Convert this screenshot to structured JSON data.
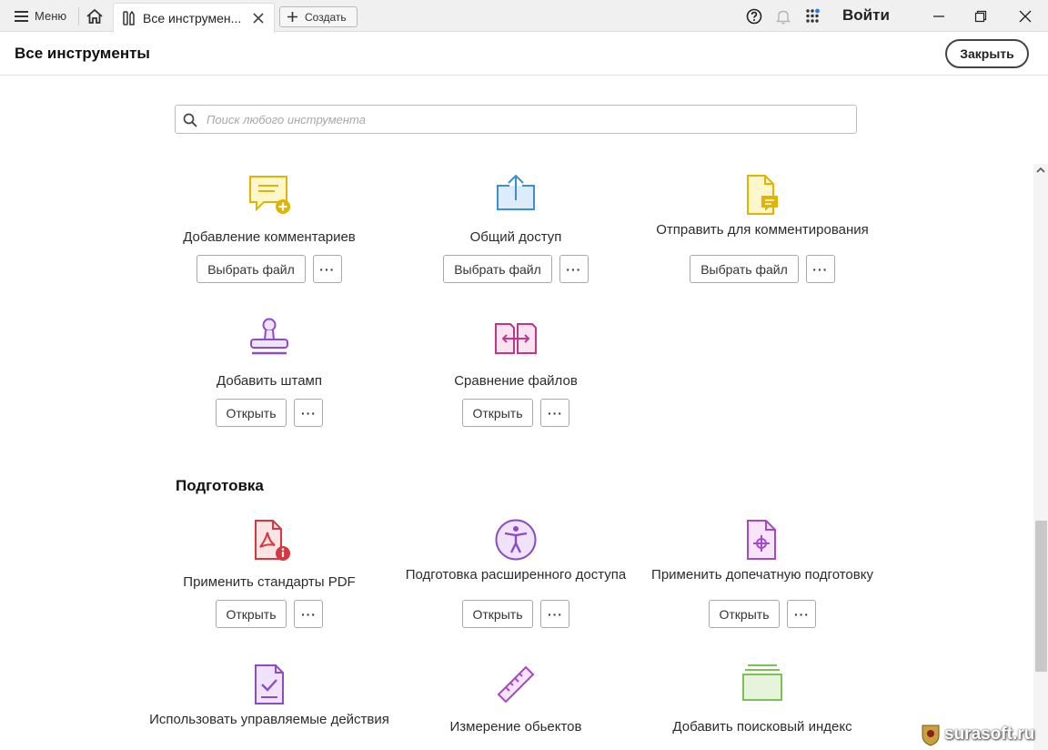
{
  "topbar": {
    "menu_label": "Меню",
    "tab_label": "Все инструмен...",
    "create_label": "Создать",
    "login_label": "Войти"
  },
  "header": {
    "title": "Все инструменты",
    "close_label": "Закрыть"
  },
  "search": {
    "placeholder": "Поиск любого инструмента",
    "value": ""
  },
  "tools_top": [
    {
      "name": "Добавление комментариев",
      "button": "Выбрать файл",
      "more": "···",
      "icon": "comment-icon"
    },
    {
      "name": "Общий доступ",
      "button": "Выбрать файл",
      "more": "···",
      "icon": "share-icon"
    },
    {
      "name": "Отправить для комментирования",
      "button": "Выбрать файл",
      "more": "···",
      "icon": "send-for-comments-icon"
    },
    {
      "name": "Добавить штамп",
      "button": "Открыть",
      "more": "···",
      "icon": "stamp-icon"
    },
    {
      "name": "Сравнение файлов",
      "button": "Открыть",
      "more": "···",
      "icon": "compare-icon"
    }
  ],
  "section": {
    "title": "Подготовка"
  },
  "tools_prep": [
    {
      "name": "Применить стандарты PDF",
      "button": "Открыть",
      "more": "···",
      "icon": "pdf-standards-icon"
    },
    {
      "name": "Подготовка расширенного доступа",
      "button": "Открыть",
      "more": "···",
      "icon": "accessibility-icon"
    },
    {
      "name": "Применить допечатную подготовку",
      "button": "Открыть",
      "more": "···",
      "icon": "print-production-icon"
    },
    {
      "name": "Использовать управляемые действия",
      "icon": "action-wizard-icon"
    },
    {
      "name": "Измерение обьектов",
      "icon": "measure-icon"
    },
    {
      "name": "Добавить поисковый индекс",
      "icon": "index-icon"
    }
  ],
  "watermark": "surasoft.ru",
  "colors": {
    "comment": "#e0b400",
    "share": "#3a8fd8",
    "stamp": "#8b4cc4",
    "compare": "#c2358a",
    "pdf_standards": "#d7373f",
    "accessibility": "#8b4cc4",
    "measure": "#a848c8",
    "index": "#7ac252"
  }
}
